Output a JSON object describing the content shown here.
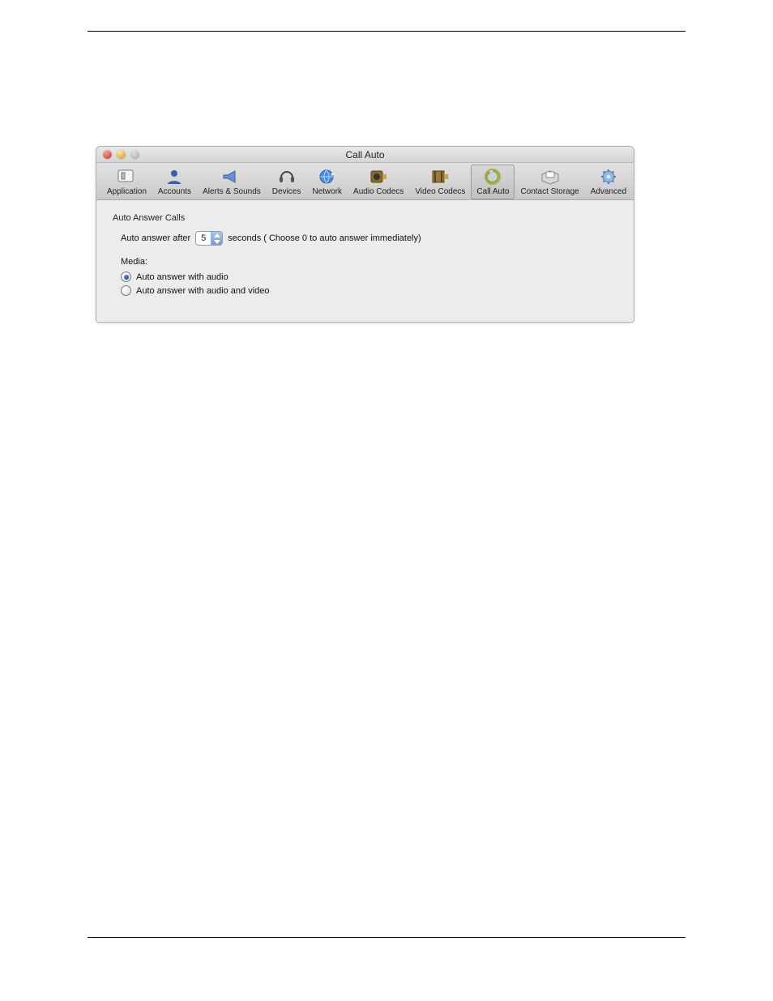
{
  "window": {
    "title": "Call Auto"
  },
  "toolbar": {
    "items": [
      {
        "label": "Application",
        "icon": "app-switch-icon"
      },
      {
        "label": "Accounts",
        "icon": "person-icon"
      },
      {
        "label": "Alerts & Sounds",
        "icon": "megaphone-icon"
      },
      {
        "label": "Devices",
        "icon": "headset-icon"
      },
      {
        "label": "Network",
        "icon": "globe-icon"
      },
      {
        "label": "Audio Codecs",
        "icon": "speaker-plug-icon"
      },
      {
        "label": "Video Codecs",
        "icon": "film-plug-icon"
      },
      {
        "label": "Call Auto",
        "icon": "auto-arrow-icon",
        "selected": true
      },
      {
        "label": "Contact Storage",
        "icon": "card-box-icon"
      },
      {
        "label": "Advanced",
        "icon": "gear-icon"
      }
    ]
  },
  "content": {
    "group_label": "Auto Answer Calls",
    "delay_prefix": "Auto answer after",
    "delay_value": "5",
    "delay_suffix": "seconds ( Choose 0 to auto answer immediately)",
    "media_label": "Media:",
    "radios": [
      {
        "label": "Auto answer with audio",
        "checked": true
      },
      {
        "label": "Auto answer with audio and video",
        "checked": false
      }
    ]
  }
}
